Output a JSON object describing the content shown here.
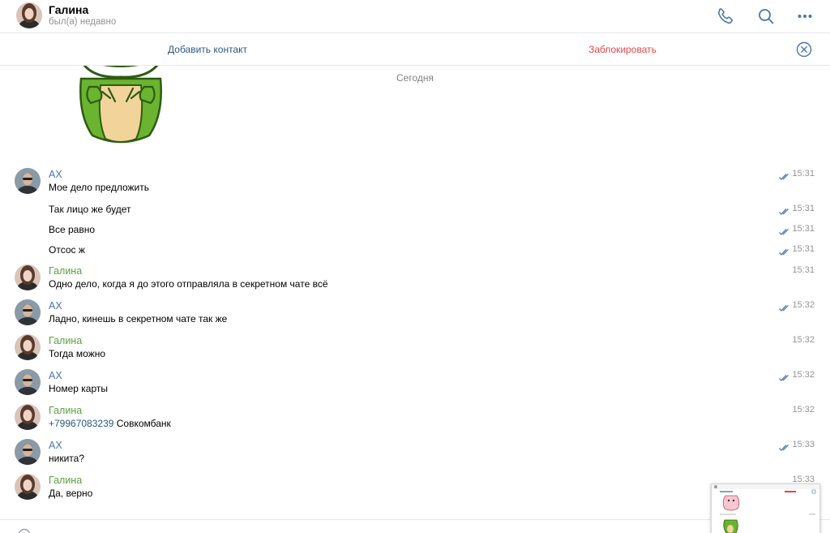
{
  "header": {
    "name": "Галина",
    "status": "был(а) недавно",
    "icons": [
      "phone-icon",
      "search-icon",
      "more-icon"
    ]
  },
  "actions": {
    "add_contact": "Добавить контакт",
    "block": "Заблокировать"
  },
  "date_separator": "Сегодня",
  "messages": [
    {
      "author": "АХ",
      "text": "Мое дело предложить",
      "time": "15:31",
      "read": true
    },
    {
      "author": "",
      "text": "Так лицо же будет",
      "time": "15:31",
      "read": true
    },
    {
      "author": "",
      "text": "Все равно",
      "time": "15:31",
      "read": true
    },
    {
      "author": "",
      "text": "Отсос ж",
      "time": "15:31",
      "read": true
    },
    {
      "author": "Галина",
      "text": "Одно дело, когда я до этого отправляла в секретном чате всё",
      "time": "15:31",
      "read": false
    },
    {
      "author": "АХ",
      "text": "Ладно,  кинешь в секретном чате так же",
      "time": "15:32",
      "read": true
    },
    {
      "author": "Галина",
      "text": "Тогда можно",
      "time": "15:32",
      "read": false
    },
    {
      "author": "АХ",
      "text": "Номер карты",
      "time": "15:32",
      "read": true
    },
    {
      "author": "Галина",
      "phone": "+79967083239",
      "text": " Совкомбанк",
      "time": "15:32",
      "read": false
    },
    {
      "author": "АХ",
      "text": "никита?",
      "time": "15:33",
      "read": true
    },
    {
      "author": "Галина",
      "text": "Да, верно",
      "time": "15:33",
      "read": false
    }
  ],
  "colors": {
    "link": "#2a5885",
    "danger": "#e64646",
    "ax_name": "#4a76a8",
    "galina_name": "#5aa13f",
    "muted": "#939393"
  }
}
